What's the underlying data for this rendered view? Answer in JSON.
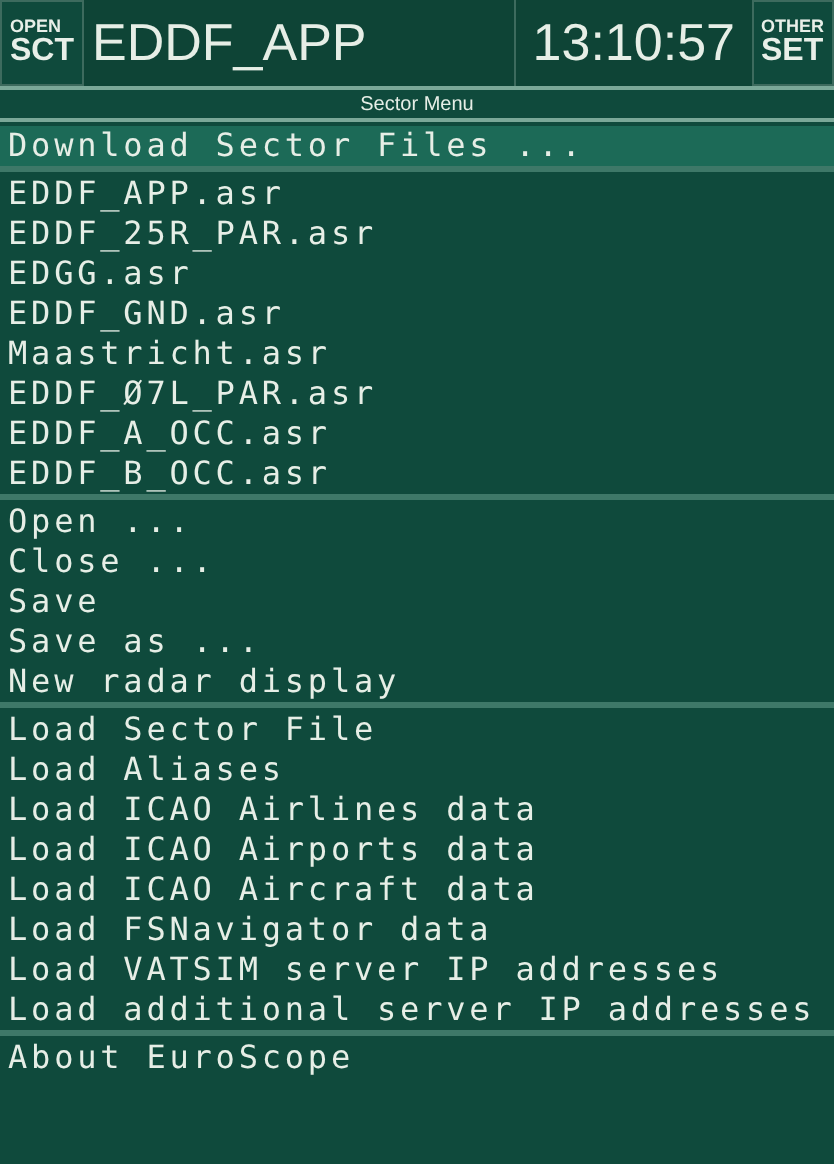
{
  "header": {
    "left_button": {
      "top": "OPEN",
      "bottom": "SCT"
    },
    "title": "EDDF_APP",
    "time": "13:10:57",
    "right_button": {
      "top": "OTHER",
      "bottom": "SET"
    }
  },
  "menu": {
    "title": "Sector Menu",
    "groups": [
      [
        {
          "label": "Download Sector Files ...",
          "selected": true
        }
      ],
      [
        {
          "label": "EDDF_APP.asr",
          "selected": false
        },
        {
          "label": "EDDF_25R_PAR.asr",
          "selected": false
        },
        {
          "label": "EDGG.asr",
          "selected": false
        },
        {
          "label": "EDDF_GND.asr",
          "selected": false
        },
        {
          "label": "Maastricht.asr",
          "selected": false
        },
        {
          "label": "EDDF_Ø7L_PAR.asr",
          "selected": false
        },
        {
          "label": "EDDF_A_OCC.asr",
          "selected": false
        },
        {
          "label": "EDDF_B_OCC.asr",
          "selected": false
        }
      ],
      [
        {
          "label": "Open ...",
          "selected": false
        },
        {
          "label": "Close ...",
          "selected": false
        },
        {
          "label": "Save",
          "selected": false
        },
        {
          "label": "Save as ...",
          "selected": false
        },
        {
          "label": "New radar display",
          "selected": false
        }
      ],
      [
        {
          "label": "Load Sector File",
          "selected": false
        },
        {
          "label": "Load Aliases",
          "selected": false
        },
        {
          "label": "Load ICAO Airlines data",
          "selected": false
        },
        {
          "label": "Load ICAO Airports data",
          "selected": false
        },
        {
          "label": "Load ICAO Aircraft data",
          "selected": false
        },
        {
          "label": "Load FSNavigator data",
          "selected": false
        },
        {
          "label": "Load VATSIM server IP addresses",
          "selected": false
        },
        {
          "label": "Load additional server IP addresses",
          "selected": false
        }
      ],
      [
        {
          "label": "About EuroScope",
          "selected": false
        }
      ]
    ]
  }
}
